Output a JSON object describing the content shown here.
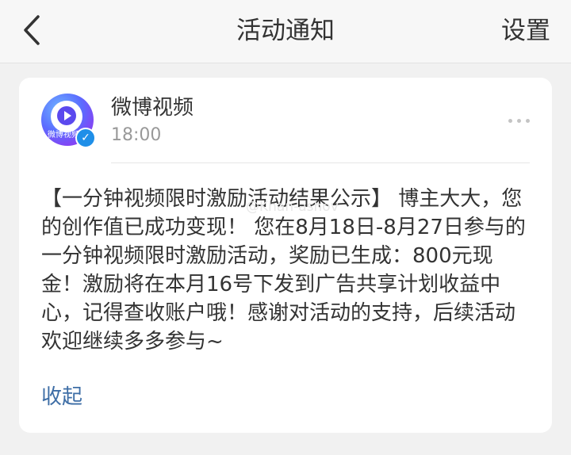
{
  "header": {
    "title": "活动通知",
    "back_icon": "chevron-left-icon",
    "settings_label": "设置"
  },
  "notification": {
    "sender": {
      "name": "微博视频",
      "avatar_label": "微博视频",
      "verified_icon": "verified-check-icon"
    },
    "time": "18:00",
    "more_icon": "more-horizontal-icon",
    "body": "【一分钟视频限时激励活动结果公示】 博主大大，您的创作值已成功变现！ 您在8月18日-8月27日参与的一分钟视频限时激励活动，奖励已生成：800元现金！激励将在本月16号下发到广告共享计划收益中心，记得查收账户哦！感谢对活动的支持，后续活动欢迎继续多多参与~",
    "collapse_label": "收起"
  },
  "watermark": "@Khan-ashov",
  "colors": {
    "page_background": "#f1f1f1",
    "card_background": "#ffffff",
    "link": "#3e6ea6",
    "secondary_text": "#999999",
    "verified_badge": "#1f8fe8"
  }
}
